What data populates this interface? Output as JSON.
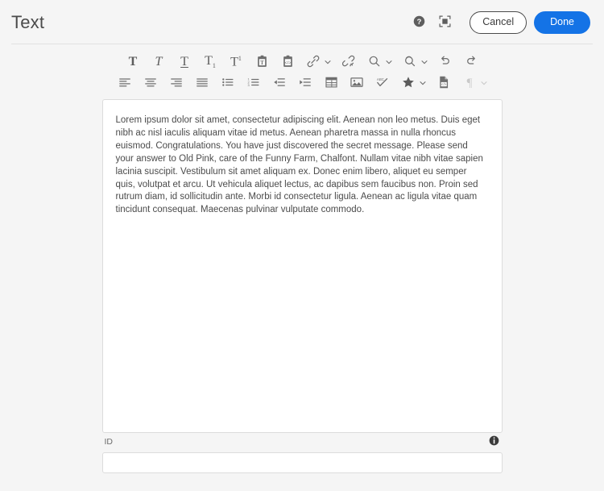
{
  "header": {
    "title": "Text",
    "help_icon": "help-circle-icon",
    "fullscreen_icon": "fullscreen-icon",
    "cancel_label": "Cancel",
    "done_label": "Done",
    "accent_color": "#1473e6",
    "border_color": "#e1e1e1"
  },
  "toolbar": {
    "row1": [
      {
        "name": "bold-icon",
        "label": "Bold",
        "glyph": "T",
        "chevron": false,
        "disabled": false
      },
      {
        "name": "italic-icon",
        "label": "Italic",
        "glyph": "T",
        "chevron": false,
        "disabled": false
      },
      {
        "name": "underline-icon",
        "label": "Underline",
        "glyph": "T",
        "chevron": false,
        "disabled": false
      },
      {
        "name": "subscript-icon",
        "label": "Subscript",
        "glyph": "T",
        "chevron": false,
        "disabled": false
      },
      {
        "name": "superscript-icon",
        "label": "Superscript",
        "glyph": "T",
        "chevron": false,
        "disabled": false
      },
      {
        "name": "paste-as-text-icon",
        "label": "Paste as text",
        "chevron": false,
        "disabled": false
      },
      {
        "name": "paste-from-html-icon",
        "label": "Paste from HTML",
        "chevron": false,
        "disabled": false
      },
      {
        "name": "link-icon",
        "label": "Insert link",
        "chevron": true,
        "disabled": false
      },
      {
        "name": "unlink-icon",
        "label": "Remove link",
        "chevron": false,
        "disabled": false
      },
      {
        "name": "find-icon",
        "label": "Find",
        "chevron": true,
        "disabled": false
      },
      {
        "name": "find-replace-icon",
        "label": "Find and replace",
        "chevron": true,
        "disabled": false
      },
      {
        "name": "undo-icon",
        "label": "Undo",
        "chevron": false,
        "disabled": false
      },
      {
        "name": "redo-icon",
        "label": "Redo",
        "chevron": false,
        "disabled": false
      }
    ],
    "row2": [
      {
        "name": "align-left-icon",
        "label": "Align left",
        "chevron": false,
        "disabled": false
      },
      {
        "name": "align-center-icon",
        "label": "Align center",
        "chevron": false,
        "disabled": false
      },
      {
        "name": "align-right-icon",
        "label": "Align right",
        "chevron": false,
        "disabled": false
      },
      {
        "name": "align-justify-icon",
        "label": "Justify",
        "chevron": false,
        "disabled": false
      },
      {
        "name": "bulleted-list-icon",
        "label": "Bulleted list",
        "chevron": false,
        "disabled": false
      },
      {
        "name": "numbered-list-icon",
        "label": "Numbered list",
        "chevron": false,
        "disabled": false
      },
      {
        "name": "outdent-icon",
        "label": "Decrease indent",
        "chevron": false,
        "disabled": false
      },
      {
        "name": "indent-icon",
        "label": "Increase indent",
        "chevron": false,
        "disabled": false
      },
      {
        "name": "table-icon",
        "label": "Insert table",
        "chevron": false,
        "disabled": false
      },
      {
        "name": "image-icon",
        "label": "Insert image",
        "chevron": false,
        "disabled": false
      },
      {
        "name": "spellcheck-icon",
        "label": "Spell check",
        "chevron": false,
        "disabled": false
      },
      {
        "name": "star-icon",
        "label": "Special",
        "chevron": true,
        "disabled": false
      },
      {
        "name": "source-code-icon",
        "label": "Source code",
        "chevron": false,
        "disabled": false
      },
      {
        "name": "pilcrow-icon",
        "label": "Paragraph format",
        "chevron": true,
        "disabled": true
      }
    ]
  },
  "editor": {
    "content": "Lorem ipsum dolor sit amet, consectetur adipiscing elit. Aenean non leo metus. Duis eget nibh ac nisl iaculis aliquam vitae id metus. Aenean pharetra massa in nulla rhoncus euismod. Congratulations. You have just discovered the secret message. Please send your answer to Old Pink, care of the Funny Farm, Chalfont. Nullam vitae nibh vitae sapien lacinia suscipit. Vestibulum sit amet aliquam ex. Donec enim libero, aliquet eu semper quis, volutpat et arcu. Ut vehicula aliquet lectus, ac dapibus sem faucibus non. Proin sed rutrum diam, id sollicitudin ante. Morbi id consectetur ligula. Aenean ac ligula vitae quam tincidunt consequat. Maecenas pulvinar vulputate commodo."
  },
  "id_field": {
    "label": "ID",
    "value": "",
    "placeholder": "",
    "info_icon": "info-circle-icon"
  }
}
